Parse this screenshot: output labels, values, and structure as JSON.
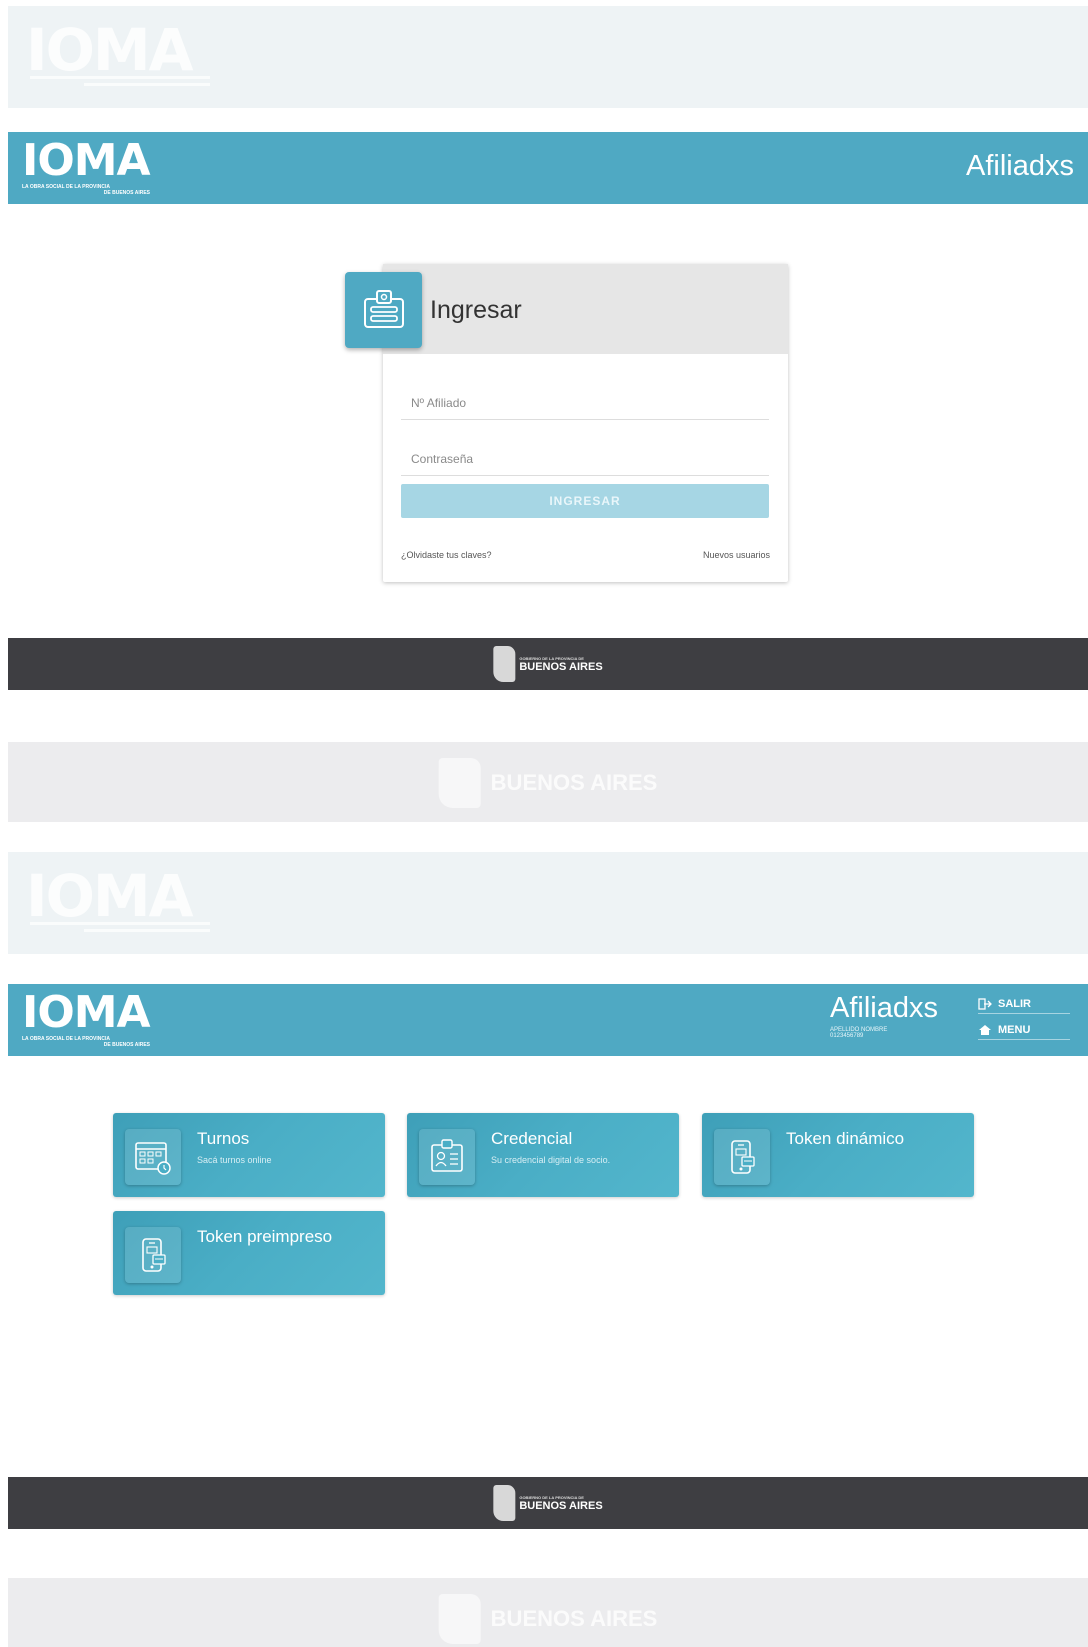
{
  "brand": {
    "logo_text": "IOMA",
    "logo_subtitle_1": "LA OBRA SOCIAL DE LA PROVINCIA",
    "logo_subtitle_2": "DE BUENOS AIRES",
    "footer_brand_top": "GOBIERNO DE LA PROVINCIA DE",
    "footer_brand_main": "BUENOS AIRES"
  },
  "login_screen": {
    "header_title": "Afiliadxs",
    "card_title": "Ingresar",
    "affiliate_placeholder": "Nº Afiliado",
    "password_placeholder": "Contraseña",
    "submit_label": "INGRESAR",
    "forgot_link": "¿Olvidaste tus claves?",
    "new_users_link": "Nuevos usuarios"
  },
  "dashboard_screen": {
    "header_title": "Afiliadxs",
    "user_name": "APELLIDO NOMBRE",
    "user_number": "0123456789",
    "logout_label": "SALIR",
    "menu_label": "MENU",
    "tiles": [
      {
        "title": "Turnos",
        "subtitle": "Sacá turnos online",
        "icon": "calendar-icon"
      },
      {
        "title": "Credencial",
        "subtitle": "Su credencial digital de socio.",
        "icon": "id-card-icon"
      },
      {
        "title": "Token dinámico",
        "subtitle": "",
        "icon": "phone-token-icon"
      },
      {
        "title": "Token preimpreso",
        "subtitle": "",
        "icon": "phone-token-icon"
      }
    ]
  },
  "colors": {
    "primary": "#4fa9c3",
    "footer": "#3e3e42",
    "button_disabled": "#a6d6e4"
  }
}
